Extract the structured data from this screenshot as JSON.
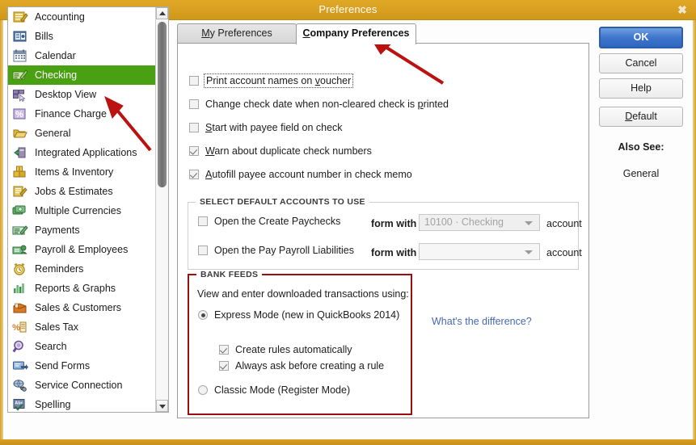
{
  "window": {
    "title": "Preferences",
    "close_icon": "close-icon",
    "titlebar_color": "#d9a021"
  },
  "sidebar": {
    "items": [
      {
        "label": "Accounting",
        "icon": "accounting-icon",
        "selected": false
      },
      {
        "label": "Bills",
        "icon": "bills-icon",
        "selected": false
      },
      {
        "label": "Calendar",
        "icon": "calendar-icon",
        "selected": false
      },
      {
        "label": "Checking",
        "icon": "checking-icon",
        "selected": true
      },
      {
        "label": "Desktop View",
        "icon": "desktop-view-icon",
        "selected": false
      },
      {
        "label": "Finance Charge",
        "icon": "finance-charge-icon",
        "selected": false
      },
      {
        "label": "General",
        "icon": "general-icon",
        "selected": false
      },
      {
        "label": "Integrated Applications",
        "icon": "integrated-applications-icon",
        "selected": false
      },
      {
        "label": "Items & Inventory",
        "icon": "items-inventory-icon",
        "selected": false
      },
      {
        "label": "Jobs & Estimates",
        "icon": "jobs-estimates-icon",
        "selected": false
      },
      {
        "label": "Multiple Currencies",
        "icon": "multiple-currencies-icon",
        "selected": false
      },
      {
        "label": "Payments",
        "icon": "payments-icon",
        "selected": false
      },
      {
        "label": "Payroll & Employees",
        "icon": "payroll-employees-icon",
        "selected": false
      },
      {
        "label": "Reminders",
        "icon": "reminders-icon",
        "selected": false
      },
      {
        "label": "Reports & Graphs",
        "icon": "reports-graphs-icon",
        "selected": false
      },
      {
        "label": "Sales & Customers",
        "icon": "sales-customers-icon",
        "selected": false
      },
      {
        "label": "Sales Tax",
        "icon": "sales-tax-icon",
        "selected": false
      },
      {
        "label": "Search",
        "icon": "search-icon",
        "selected": false
      },
      {
        "label": "Send Forms",
        "icon": "send-forms-icon",
        "selected": false
      },
      {
        "label": "Service Connection",
        "icon": "service-connection-icon",
        "selected": false
      },
      {
        "label": "Spelling",
        "icon": "spelling-icon",
        "selected": false
      }
    ],
    "selected_color": "#49a013"
  },
  "tabs": [
    {
      "label": "My Preferences",
      "accel": "M",
      "active": false
    },
    {
      "label": "Company Preferences",
      "accel": "C",
      "active": true
    }
  ],
  "checkboxes": [
    {
      "label": "Print account names on voucher",
      "accel": "v",
      "checked": false,
      "focused": true
    },
    {
      "label": "Change check date when non-cleared check is printed",
      "accel": "p",
      "checked": false,
      "focused": false
    },
    {
      "label": "Start with payee field on check",
      "accel": "S",
      "checked": false,
      "focused": false
    },
    {
      "label": "Warn about duplicate check numbers",
      "accel": "W",
      "checked": true,
      "focused": false
    },
    {
      "label": "Autofill payee account number in check memo",
      "accel": "A",
      "checked": true,
      "focused": false
    }
  ],
  "default_accounts": {
    "group_title": "SELECT DEFAULT ACCOUNTS TO USE",
    "rows": [
      {
        "checkbox_label": "Open the Create Paychecks",
        "checked": false,
        "form_with": "form with",
        "account_value": "10100 · Checking",
        "account_word": "account"
      },
      {
        "checkbox_label": "Open the Pay Payroll Liabilities",
        "checked": false,
        "form_with": "form with",
        "account_value": "",
        "account_word": "account"
      }
    ]
  },
  "bank_feeds": {
    "group_title": "BANK FEEDS",
    "intro": "View and enter downloaded transactions using:",
    "modes": [
      {
        "label": "Express Mode (new in QuickBooks 2014)",
        "selected": true
      },
      {
        "label": "Classic Mode (Register Mode)",
        "selected": false
      }
    ],
    "sub_options": [
      {
        "label": "Create rules automatically",
        "checked": true
      },
      {
        "label": "Always ask before creating a rule",
        "checked": true
      }
    ],
    "difference_link": "What's the difference?",
    "highlight_color": "#9d0f0f"
  },
  "buttons": [
    {
      "label": "OK",
      "accel": "",
      "primary": true
    },
    {
      "label": "Cancel",
      "accel": "",
      "primary": false
    },
    {
      "label": "Help",
      "accel": "",
      "primary": false
    },
    {
      "label": "Default",
      "accel": "D",
      "primary": false
    }
  ],
  "also_see": {
    "title": "Also See:",
    "link": "General"
  },
  "annotations": {
    "arrow_color": "#bb1111",
    "arrow_1_target": "Company Preferences tab",
    "arrow_2_target": "Checking sidebar item"
  }
}
